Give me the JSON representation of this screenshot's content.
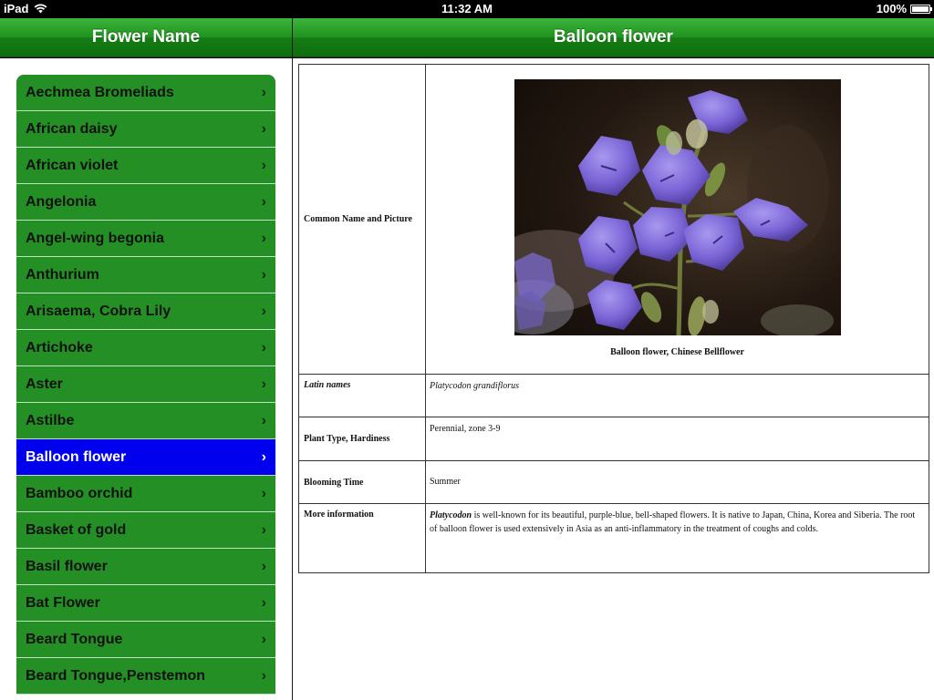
{
  "status_bar": {
    "device": "iPad",
    "time": "11:32 AM",
    "battery": "100%",
    "battery_level": 1.0
  },
  "master": {
    "title": "Flower Name",
    "items": [
      {
        "label": "Aechmea Bromeliads",
        "selected": false
      },
      {
        "label": "African daisy",
        "selected": false
      },
      {
        "label": "African violet",
        "selected": false
      },
      {
        "label": "Angelonia",
        "selected": false
      },
      {
        "label": "Angel-wing begonia",
        "selected": false
      },
      {
        "label": "Anthurium",
        "selected": false
      },
      {
        "label": "Arisaema, Cobra Lily",
        "selected": false
      },
      {
        "label": "Artichoke",
        "selected": false
      },
      {
        "label": "Aster",
        "selected": false
      },
      {
        "label": "Astilbe",
        "selected": false
      },
      {
        "label": "Balloon flower",
        "selected": true
      },
      {
        "label": "Bamboo orchid",
        "selected": false
      },
      {
        "label": "Basket of gold",
        "selected": false
      },
      {
        "label": "Basil flower",
        "selected": false
      },
      {
        "label": "Bat Flower",
        "selected": false
      },
      {
        "label": "Beard Tongue",
        "selected": false
      },
      {
        "label": "Beard Tongue,Penstemon",
        "selected": false
      }
    ],
    "chevron_icon": "chevron-right-icon"
  },
  "detail": {
    "title": "Balloon flower",
    "rows": {
      "picture_label": "Common Name and Picture",
      "picture_caption": "Balloon flower, Chinese Bellflower",
      "latin_label": "Latin names",
      "latin_value": "Platycodon grandiflorus",
      "type_label": "Plant Type, Hardiness",
      "type_value": "Perennial, zone 3-9",
      "bloom_label": "Blooming Time",
      "bloom_value": "Summer",
      "more_label": "More information",
      "more_lead": "Platycodon",
      "more_value": " is well-known for its beautiful, purple-blue, bell-shaped flowers. It is native to Japan, China, Korea and Siberia. The root of balloon flower is used extensively in Asia as an anti-inflammatory in the treatment of coughs and colds."
    }
  },
  "colors": {
    "nav_green": "#1f921f",
    "list_green": "#248f24",
    "selected_blue": "#0000ee"
  }
}
